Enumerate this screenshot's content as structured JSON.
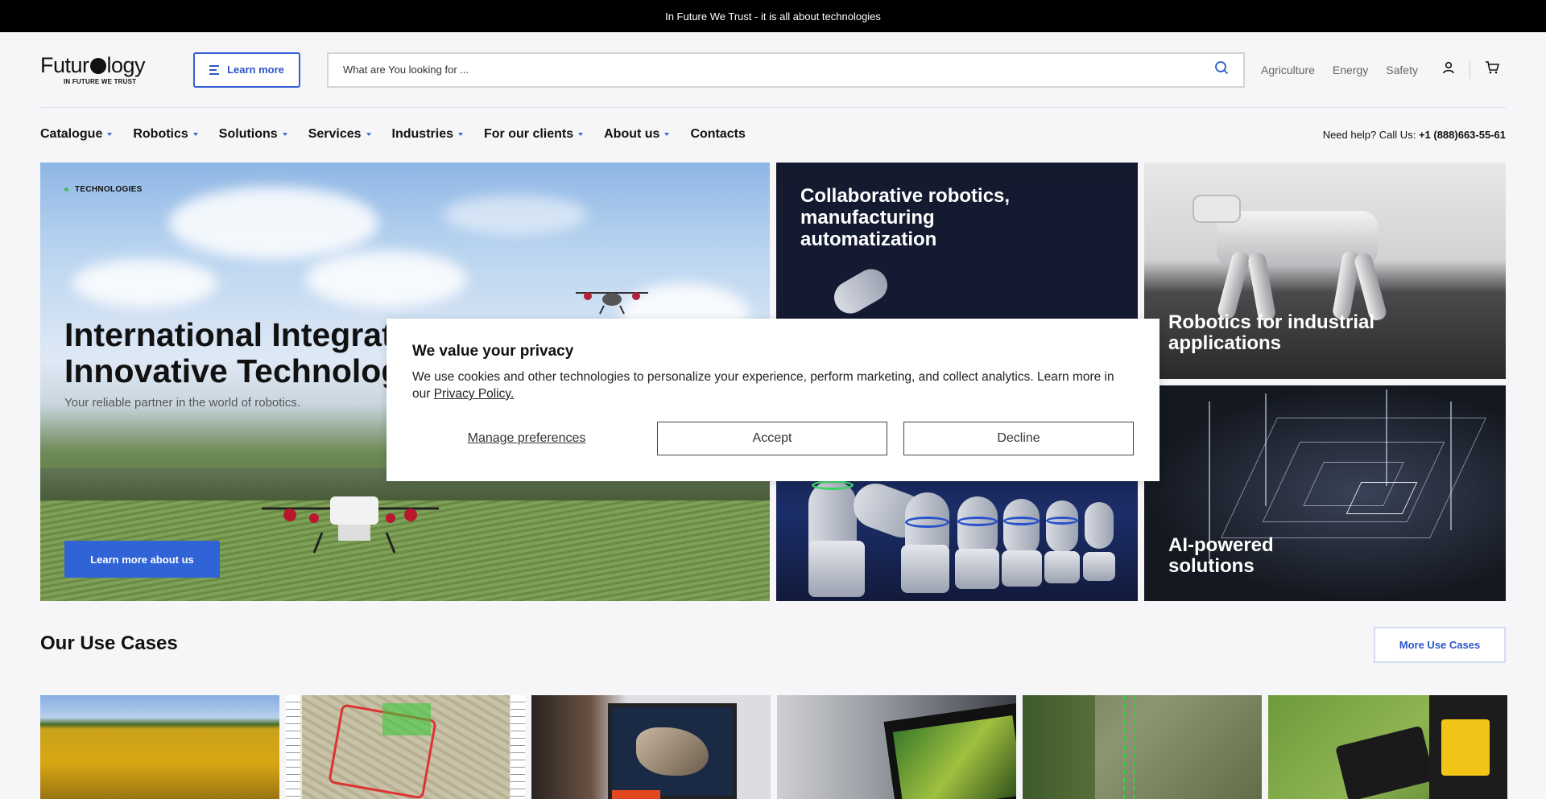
{
  "topbar": {
    "text": "In Future We Trust - it is all about technologies"
  },
  "logo": {
    "before": "Futur",
    "after": "logy",
    "tagline": "IN FUTURE WE TRUST"
  },
  "header": {
    "learn_more": "Learn more",
    "search_placeholder": "What are You looking for ...",
    "quick_links": [
      "Agriculture",
      "Energy",
      "Safety"
    ],
    "icons": [
      "search-icon",
      "user-icon",
      "cart-icon",
      "menu-icon"
    ]
  },
  "nav": {
    "items": [
      "Catalogue",
      "Robotics",
      "Solutions",
      "Services",
      "Industries",
      "For our clients",
      "About us",
      "Contacts"
    ],
    "help_label": "Need help? Call Us:",
    "help_phone": "+1 (888)663-55-61"
  },
  "hero": {
    "tag": "TECHNOLOGIES",
    "title": "International Integrated\nInnovative Technologies",
    "subtitle": "Your reliable partner in the world of robotics.",
    "button": "Learn more about us"
  },
  "cards": {
    "cobot": "Collaborative robotics,\nmanufacturing\nautomatization",
    "robodog": "Robotics for industrial\napplications",
    "ai": "AI-powered\nsolutions"
  },
  "cookie": {
    "title": "We value your privacy",
    "text": "We use cookies and other technologies to personalize your experience, perform marketing, and collect analytics. Learn more in our ",
    "link": "Privacy Policy.",
    "manage": "Manage preferences",
    "accept": "Accept",
    "decline": "Decline"
  },
  "usecases": {
    "title": "Our Use Cases",
    "more": "More Use Cases"
  },
  "colors": {
    "accent": "#2f63d6",
    "topbar": "#000000",
    "dark_card": "#141a2e"
  }
}
